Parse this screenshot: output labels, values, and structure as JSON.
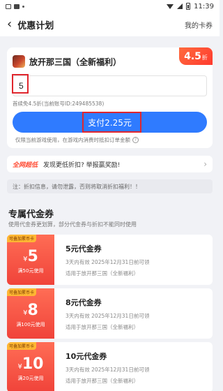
{
  "status_bar": {
    "time": "11:39"
  },
  "header": {
    "title": "优惠计划",
    "right_link": "我的卡券",
    "back_icon": "chevron-left-icon"
  },
  "pay_card": {
    "discount": "4.5",
    "discount_unit": "折",
    "game_name": "放开那三国（全新福利）",
    "amount_value": "5",
    "account_info": "首续免4.5折(当前账号ID:249485538)",
    "pay_button_label": "支付2.25元",
    "pay_note": "仅限当前游戏使用，在游戏内消费时抵扣订单金额"
  },
  "report": {
    "logo_text": "全网超低",
    "text": "发现更低折扣? 举报赢奖励!"
  },
  "notice": {
    "text": "注：折扣信息，请勿泄露，否则将取消折扣福利！！"
  },
  "coupon_section": {
    "title": "专属代金券",
    "subtitle": "使用代金券更划算，部分代金券与折扣不能同时使用"
  },
  "coupons": [
    {
      "tag": "可叠加累币卡",
      "currency": "¥",
      "value": "5",
      "min_spend": "满50元使用",
      "title": "5元代金券",
      "validity": "3天内有效 2025年12月31日前可领",
      "scope": "适用于放开那三国（全新福利）"
    },
    {
      "tag": "可叠加累币卡",
      "currency": "¥",
      "value": "8",
      "min_spend": "满100元使用",
      "title": "8元代金券",
      "validity": "3天内有效 2025年12月31日前可领",
      "scope": "适用于放开那三国（全新福利）"
    },
    {
      "tag": "可叠加累币卡",
      "currency": "¥",
      "value": "10",
      "min_spend": "满20元使用",
      "title": "10元代金券",
      "validity": "3天内有效 2025年12月31日前可领",
      "scope": "适用于放开那三国（全新福利）"
    }
  ],
  "colors": {
    "accent_blue": "#2f7bff",
    "accent_red": "#f0433a",
    "highlight_red": "#e0262d"
  }
}
